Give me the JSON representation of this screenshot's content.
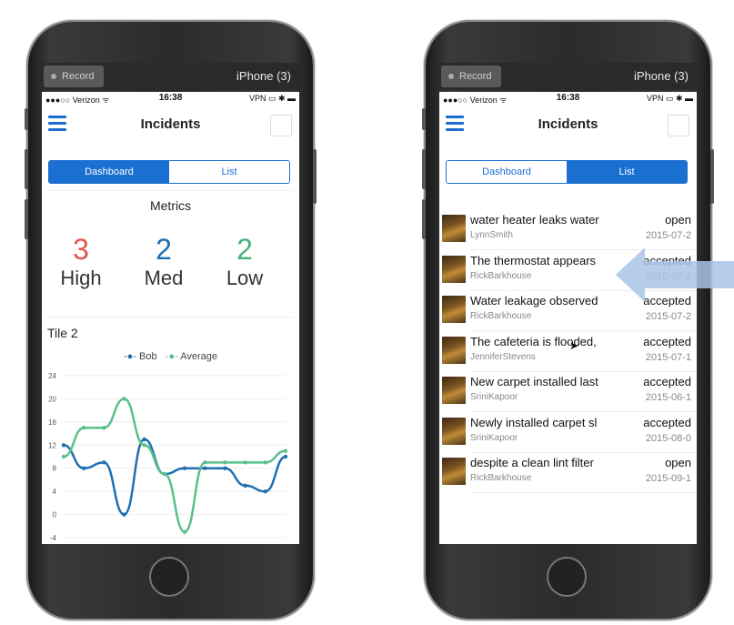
{
  "recorder": {
    "record_label": "Record",
    "device_label": "iPhone (3)"
  },
  "status_bar": {
    "carrier": "●●●○○ Verizon ᯤ",
    "time": "16:38",
    "right": "VPN ▭ ✱ ▬"
  },
  "nav": {
    "title": "Incidents"
  },
  "segments": {
    "dashboard": "Dashboard",
    "list": "List"
  },
  "dashboard": {
    "metrics_title": "Metrics",
    "metrics": [
      {
        "count": "3",
        "label": "High",
        "color": "#e0574a"
      },
      {
        "count": "2",
        "label": "Med",
        "color": "#1a6fb5"
      },
      {
        "count": "2",
        "label": "Low",
        "color": "#4aaf7c"
      }
    ],
    "tile2_title": "Tile 2"
  },
  "chart_data": {
    "type": "line",
    "title": "",
    "x": [
      0,
      1,
      2,
      3,
      4,
      5,
      6,
      7,
      8,
      9,
      10,
      11
    ],
    "series": [
      {
        "name": "Bob",
        "color": "#1f6fb0",
        "values": [
          12,
          8,
          9,
          0,
          13,
          7,
          8,
          8,
          8,
          5,
          4,
          10
        ]
      },
      {
        "name": "Average",
        "color": "#59c08a",
        "values": [
          10,
          15,
          15,
          20,
          12,
          7,
          -3,
          9,
          9,
          9,
          9,
          11
        ]
      }
    ],
    "yticks": [
      "24",
      "20",
      "16",
      "12",
      "8",
      "4",
      "0",
      "-4"
    ],
    "ylim": [
      -4,
      24
    ],
    "grid": true,
    "legend": "top-center"
  },
  "incidents": [
    {
      "title": "water heater leaks water",
      "user": "LynnSmith",
      "status": "open",
      "date": "2015-07-2"
    },
    {
      "title": "The thermostat appears",
      "user": "RickBarkhouse",
      "status": "accepted",
      "date": "2015-07-1"
    },
    {
      "title": "Water leakage observed",
      "user": "RickBarkhouse",
      "status": "accepted",
      "date": "2015-07-2"
    },
    {
      "title": "The cafeteria is flooded,",
      "user": "JenniferStevens",
      "status": "accepted",
      "date": "2015-07-1"
    },
    {
      "title": "New carpet installed last",
      "user": "SriniKapoor",
      "status": "accepted",
      "date": "2015-06-1"
    },
    {
      "title": "Newly installed carpet sl",
      "user": "SriniKapoor",
      "status": "accepted",
      "date": "2015-08-0"
    },
    {
      "title": "despite a clean lint filter",
      "user": "RickBarkhouse",
      "status": "open",
      "date": "2015-09-1"
    }
  ],
  "colors": {
    "accent": "#1a6fd1",
    "arrow": "#a9c4e6"
  }
}
